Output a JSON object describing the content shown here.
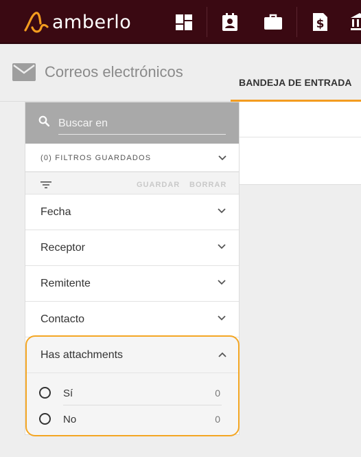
{
  "app": {
    "brand": "amberlo",
    "brand_color": "#f39c1f",
    "topbar_color": "#3a0912",
    "nav_icons": [
      "dashboard-icon",
      "calendar-contact-icon",
      "briefcase-icon",
      "invoice-dollar-icon",
      "bank-icon"
    ]
  },
  "header": {
    "title": "Correos electrónicos",
    "icon": "mail-icon",
    "active_tab": "BANDEJA DE ENTRADA"
  },
  "filters": {
    "search_placeholder": "Buscar en",
    "saved_filters_label": "(0) FILTROS GUARDADOS",
    "save_label": "GUARDAR",
    "clear_label": "BORRAR",
    "sections": [
      {
        "label": "Fecha",
        "expanded": false
      },
      {
        "label": "Receptor",
        "expanded": false
      },
      {
        "label": "Remitente",
        "expanded": false
      },
      {
        "label": "Contacto",
        "expanded": false
      }
    ],
    "attachments": {
      "label": "Has attachments",
      "expanded": true,
      "options": [
        {
          "label": "Sí",
          "count": "0",
          "selected": false
        },
        {
          "label": "No",
          "count": "0",
          "selected": false
        }
      ]
    }
  }
}
